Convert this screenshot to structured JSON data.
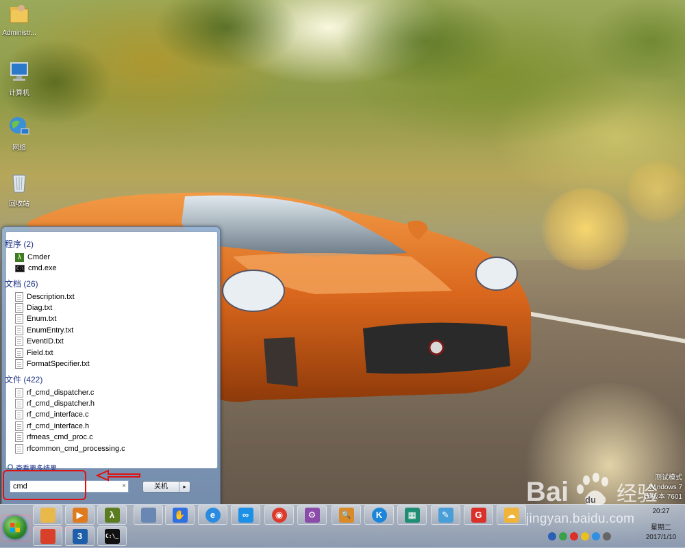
{
  "desktop": {
    "icons": [
      {
        "label": "Administr...",
        "icon": "user-folder-icon"
      },
      {
        "label": "计算机",
        "icon": "computer-icon"
      },
      {
        "label": "网络",
        "icon": "network-icon"
      },
      {
        "label": "回收站",
        "icon": "recycle-bin-icon"
      }
    ],
    "os_info": {
      "line1": "测试模式",
      "line2": "Windows 7",
      "line3": "部版本 7601"
    }
  },
  "start_menu": {
    "groups": [
      {
        "title": "程序 (2)",
        "items": [
          {
            "label": "Cmder",
            "icon": "cmder-icon"
          },
          {
            "label": "cmd.exe",
            "icon": "cmd-icon"
          }
        ]
      },
      {
        "title": "文档 (26)",
        "items": [
          {
            "label": "Description.txt",
            "icon": "text-file-icon"
          },
          {
            "label": "Diag.txt",
            "icon": "text-file-icon"
          },
          {
            "label": "Enum.txt",
            "icon": "text-file-icon"
          },
          {
            "label": "EnumEntry.txt",
            "icon": "text-file-icon"
          },
          {
            "label": "EventID.txt",
            "icon": "text-file-icon"
          },
          {
            "label": "Field.txt",
            "icon": "text-file-icon"
          },
          {
            "label": "FormatSpecifier.txt",
            "icon": "text-file-icon"
          }
        ]
      },
      {
        "title": "文件 (422)",
        "items": [
          {
            "label": "rf_cmd_dispatcher.c",
            "icon": "text-file-icon"
          },
          {
            "label": "rf_cmd_dispatcher.h",
            "icon": "text-file-icon"
          },
          {
            "label": "rf_cmd_interface.c",
            "icon": "text-file-icon"
          },
          {
            "label": "rf_cmd_interface.h",
            "icon": "text-file-icon"
          },
          {
            "label": "rfmeas_cmd_proc.c",
            "icon": "text-file-icon"
          },
          {
            "label": "rfcommon_cmd_processing.c",
            "icon": "text-file-icon"
          }
        ]
      }
    ],
    "see_more": "查看更多结果",
    "search_value": "cmd",
    "clear_glyph": "×",
    "shutdown_label": "关机",
    "shutdown_arrow": "▸"
  },
  "taskbar": {
    "pinned": [
      {
        "name": "explorer",
        "icon": "folder-icon",
        "color": "#e8b84a",
        "glyph": ""
      },
      {
        "name": "media-player",
        "icon": "media-player-icon",
        "color": "#e07a1f",
        "glyph": "▶"
      },
      {
        "name": "cmder",
        "icon": "cmder-icon",
        "color": "#5c7d1f",
        "glyph": "λ"
      },
      {
        "name": "network-tool",
        "icon": "network-computer-icon",
        "color": "#6a87b3",
        "glyph": ""
      },
      {
        "name": "baidu",
        "icon": "baidu-paw-icon",
        "color": "#2f6fe0",
        "glyph": "✋"
      },
      {
        "name": "internet-explorer",
        "icon": "ie-icon",
        "color": "#2a8be0",
        "glyph": "e"
      },
      {
        "name": "baidu-cloud",
        "icon": "cloud-icon",
        "color": "#1c8fe6",
        "glyph": "∞"
      },
      {
        "name": "chrome",
        "icon": "chrome-icon",
        "color": "#db3a2c",
        "glyph": "◉"
      },
      {
        "name": "installer",
        "icon": "installer-icon",
        "color": "#8b4ba8",
        "glyph": "⚙"
      },
      {
        "name": "search-tool",
        "icon": "magnifier-icon",
        "color": "#d98b2a",
        "glyph": "🔍"
      },
      {
        "name": "kugou",
        "icon": "kugou-icon",
        "color": "#1b86d9",
        "glyph": "K"
      },
      {
        "name": "calculator",
        "icon": "calculator-icon",
        "color": "#1f8c74",
        "glyph": "▦"
      },
      {
        "name": "paint",
        "icon": "paint-icon",
        "color": "#4a9ed8",
        "glyph": "✎"
      },
      {
        "name": "foxit",
        "icon": "foxit-icon",
        "color": "#d9302a",
        "glyph": "G"
      },
      {
        "name": "weather",
        "icon": "weather-icon",
        "color": "#f0b43a",
        "glyph": "☁"
      }
    ],
    "second_row": [
      {
        "name": "windows-explorer",
        "icon": "windows-flag-icon",
        "color": "#d9402a",
        "glyph": ""
      },
      {
        "name": "wave-tool",
        "icon": "waveform-icon",
        "color": "#1f5ea8",
        "glyph": "3"
      },
      {
        "name": "console",
        "icon": "console-icon",
        "color": "#111111",
        "glyph": "C:\\_"
      }
    ],
    "clock": {
      "time": "20:27",
      "day": "星期二",
      "date": "2017/1/10"
    }
  },
  "watermark": {
    "brand": "Bai",
    "brand_tail": "du",
    "cn": "经验",
    "url": "jingyan.baidu.com"
  },
  "colors": {
    "annotation_red": "#e01010",
    "menu_group_title": "#1e3287"
  }
}
